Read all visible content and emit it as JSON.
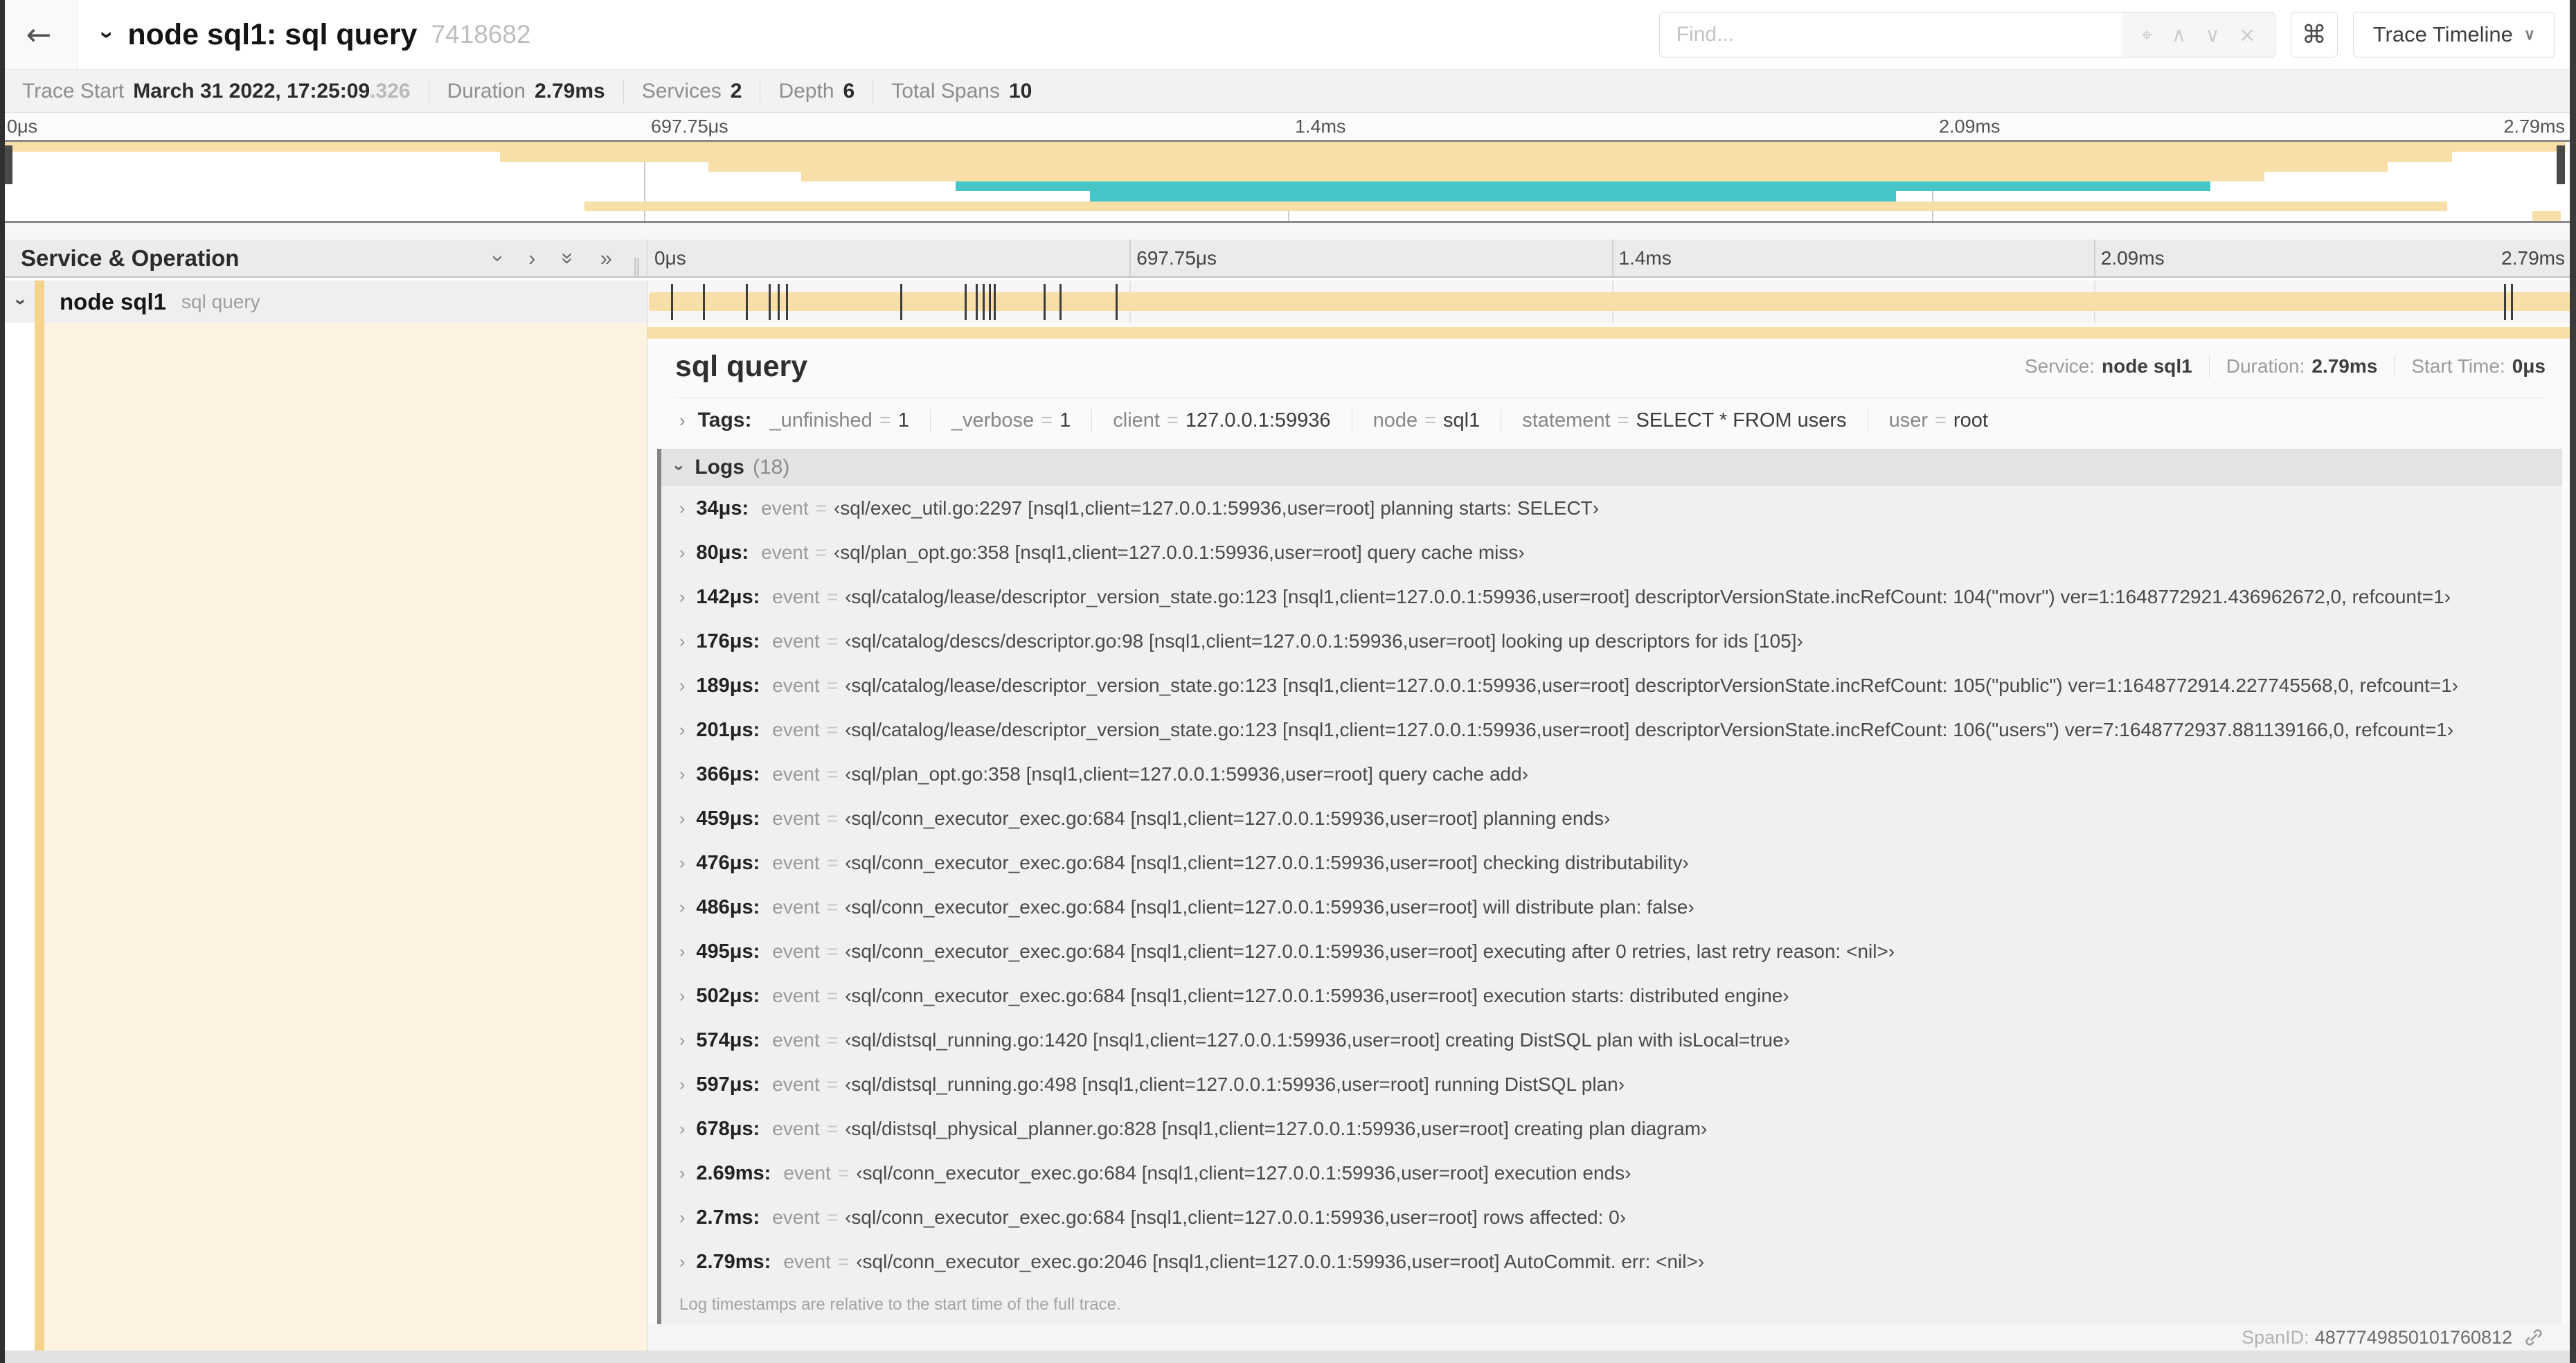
{
  "trace_total_us": 2790,
  "colors": {
    "tan": "#f8dfa8",
    "teal": "#46c5c9",
    "accent_stripe": "#f5d38b",
    "cream": "#fdf3e0"
  },
  "header": {
    "back_glyph": "←",
    "title_chevron_glyph": "›",
    "title": "node sql1: sql query",
    "trace_id": "7418682",
    "find": {
      "placeholder": "Find...",
      "locate_glyph": "⌖",
      "prev_glyph": "∧",
      "next_glyph": "∨",
      "clear_glyph": "×"
    },
    "shortcut_glyph": "⌘",
    "view_selector_label": "Trace Timeline",
    "view_selector_caret": "∨"
  },
  "trace_info": {
    "items": [
      {
        "label": "Trace Start",
        "value": "March 31 2022, 17:25:09",
        "suffix": ".326"
      },
      {
        "label": "Duration",
        "value": "2.79ms",
        "suffix": ""
      },
      {
        "label": "Services",
        "value": "2",
        "suffix": ""
      },
      {
        "label": "Depth",
        "value": "6",
        "suffix": ""
      },
      {
        "label": "Total Spans",
        "value": "10",
        "suffix": ""
      }
    ]
  },
  "time_labels": [
    {
      "pos": 0,
      "text": "0μs"
    },
    {
      "pos": 25,
      "text": "697.75μs"
    },
    {
      "pos": 50,
      "text": "1.4ms"
    },
    {
      "pos": 75,
      "text": "2.09ms"
    },
    {
      "pos": 100,
      "text": "2.79ms"
    }
  ],
  "grid_percents": [
    25,
    50,
    75,
    100
  ],
  "minimap": {
    "spans": [
      {
        "start": 0,
        "end": 99.6,
        "color": "tan"
      },
      {
        "start": 19.4,
        "end": 95.2,
        "color": "tan"
      },
      {
        "start": 27.5,
        "end": 92.7,
        "color": "tan"
      },
      {
        "start": 31.1,
        "end": 87.9,
        "color": "tan"
      },
      {
        "start": 37.1,
        "end": 85.8,
        "color": "teal"
      },
      {
        "start": 42.3,
        "end": 73.6,
        "color": "teal"
      },
      {
        "start": 22.7,
        "end": 95.0,
        "color": "tan"
      },
      {
        "start": 98.3,
        "end": 99.4,
        "color": "tan"
      }
    ]
  },
  "timeline": {
    "left_header": "Service & Operation",
    "collapse_one_glyph": "›",
    "expand_one_glyph": "›",
    "collapse_all_glyph": "»",
    "expand_all_glyph": "»",
    "grip_glyph": "‖",
    "row": {
      "chevron_glyph": "›",
      "service": "node sql1",
      "operation": "sql query"
    }
  },
  "detail": {
    "title": "sql query",
    "meta": [
      {
        "label": "Service:",
        "value": "node sql1"
      },
      {
        "label": "Duration:",
        "value": "2.79ms"
      },
      {
        "label": "Start Time:",
        "value": "0μs"
      }
    ],
    "tags_chevron": "›",
    "tags_label": "Tags:",
    "tags": [
      {
        "key": "_unfinished",
        "value": "1"
      },
      {
        "key": "_verbose",
        "value": "1"
      },
      {
        "key": "client",
        "value": "127.0.0.1:59936"
      },
      {
        "key": "node",
        "value": "sql1"
      },
      {
        "key": "statement",
        "value": "SELECT * FROM users"
      },
      {
        "key": "user",
        "value": "root"
      }
    ],
    "logs_chevron": "›",
    "logs_label": "Logs",
    "logs_count": "(18)",
    "logs": [
      {
        "ts": "34μs:",
        "ts_us": 34,
        "key": "event",
        "value": "‹sql/exec_util.go:2297 [nsql1,client=127.0.0.1:59936,user=root] planning starts: SELECT›"
      },
      {
        "ts": "80μs:",
        "ts_us": 80,
        "key": "event",
        "value": "‹sql/plan_opt.go:358 [nsql1,client=127.0.0.1:59936,user=root] query cache miss›"
      },
      {
        "ts": "142μs:",
        "ts_us": 142,
        "key": "event",
        "value": "‹sql/catalog/lease/descriptor_version_state.go:123 [nsql1,client=127.0.0.1:59936,user=root] descriptorVersionState.incRefCount: 104(\"movr\") ver=1:1648772921.436962672,0, refcount=1›"
      },
      {
        "ts": "176μs:",
        "ts_us": 176,
        "key": "event",
        "value": "‹sql/catalog/descs/descriptor.go:98 [nsql1,client=127.0.0.1:59936,user=root] looking up descriptors for ids [105]›"
      },
      {
        "ts": "189μs:",
        "ts_us": 189,
        "key": "event",
        "value": "‹sql/catalog/lease/descriptor_version_state.go:123 [nsql1,client=127.0.0.1:59936,user=root] descriptorVersionState.incRefCount: 105(\"public\") ver=1:1648772914.227745568,0, refcount=1›"
      },
      {
        "ts": "201μs:",
        "ts_us": 201,
        "key": "event",
        "value": "‹sql/catalog/lease/descriptor_version_state.go:123 [nsql1,client=127.0.0.1:59936,user=root] descriptorVersionState.incRefCount: 106(\"users\") ver=7:1648772937.881139166,0, refcount=1›"
      },
      {
        "ts": "366μs:",
        "ts_us": 366,
        "key": "event",
        "value": "‹sql/plan_opt.go:358 [nsql1,client=127.0.0.1:59936,user=root] query cache add›"
      },
      {
        "ts": "459μs:",
        "ts_us": 459,
        "key": "event",
        "value": "‹sql/conn_executor_exec.go:684 [nsql1,client=127.0.0.1:59936,user=root] planning ends›"
      },
      {
        "ts": "476μs:",
        "ts_us": 476,
        "key": "event",
        "value": "‹sql/conn_executor_exec.go:684 [nsql1,client=127.0.0.1:59936,user=root] checking distributability›"
      },
      {
        "ts": "486μs:",
        "ts_us": 486,
        "key": "event",
        "value": "‹sql/conn_executor_exec.go:684 [nsql1,client=127.0.0.1:59936,user=root] will distribute plan: false›"
      },
      {
        "ts": "495μs:",
        "ts_us": 495,
        "key": "event",
        "value": "‹sql/conn_executor_exec.go:684 [nsql1,client=127.0.0.1:59936,user=root] executing after 0 retries, last retry reason: <nil>›"
      },
      {
        "ts": "502μs:",
        "ts_us": 502,
        "key": "event",
        "value": "‹sql/conn_executor_exec.go:684 [nsql1,client=127.0.0.1:59936,user=root] execution starts: distributed engine›"
      },
      {
        "ts": "574μs:",
        "ts_us": 574,
        "key": "event",
        "value": "‹sql/distsql_running.go:1420 [nsql1,client=127.0.0.1:59936,user=root] creating DistSQL plan with isLocal=true›"
      },
      {
        "ts": "597μs:",
        "ts_us": 597,
        "key": "event",
        "value": "‹sql/distsql_running.go:498 [nsql1,client=127.0.0.1:59936,user=root] running DistSQL plan›"
      },
      {
        "ts": "678μs:",
        "ts_us": 678,
        "key": "event",
        "value": "‹sql/distsql_physical_planner.go:828 [nsql1,client=127.0.0.1:59936,user=root] creating plan diagram›"
      },
      {
        "ts": "2.69ms:",
        "ts_us": 2690,
        "key": "event",
        "value": "‹sql/conn_executor_exec.go:684 [nsql1,client=127.0.0.1:59936,user=root] execution ends›"
      },
      {
        "ts": "2.7ms:",
        "ts_us": 2700,
        "key": "event",
        "value": "‹sql/conn_executor_exec.go:684 [nsql1,client=127.0.0.1:59936,user=root] rows affected: 0›"
      },
      {
        "ts": "2.79ms:",
        "ts_us": 2790,
        "key": "event",
        "value": "‹sql/conn_executor_exec.go:2046 [nsql1,client=127.0.0.1:59936,user=root] AutoCommit. err: <nil>›"
      }
    ],
    "logs_note": "Log timestamps are relative to the start time of the full trace.",
    "span_id_label": "SpanID:",
    "span_id": "4877749850101760812"
  }
}
